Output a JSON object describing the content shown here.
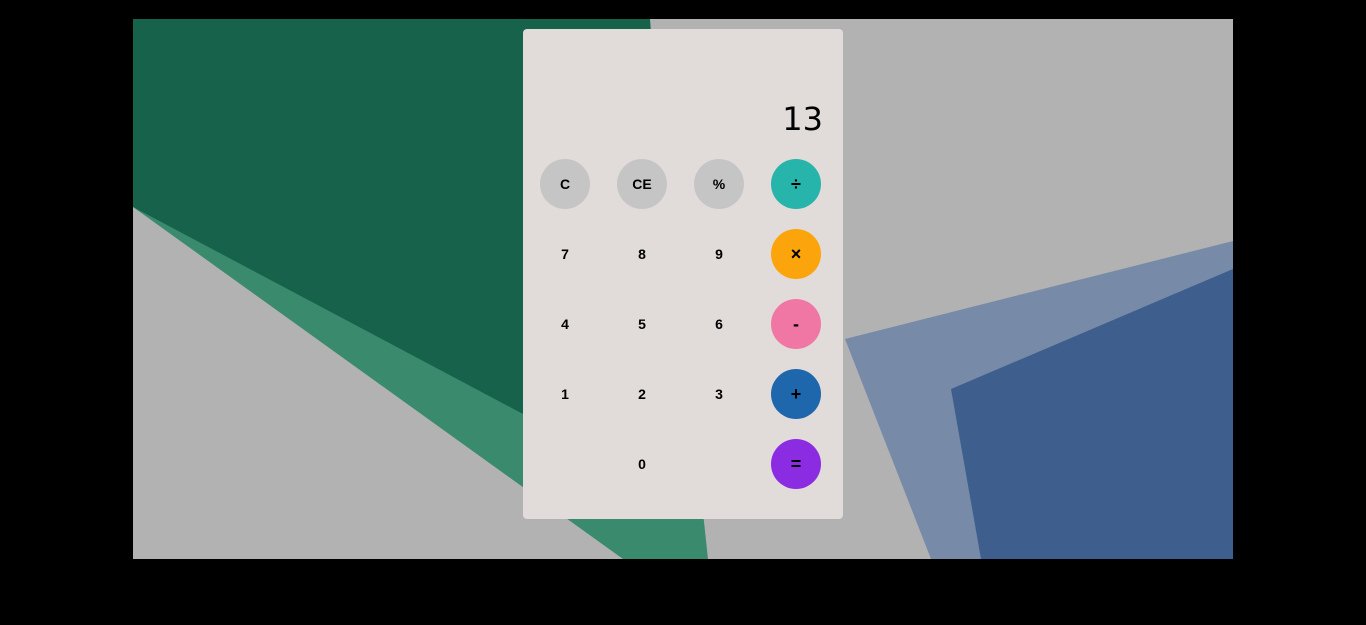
{
  "display": {
    "value": "13"
  },
  "keys": {
    "clear": "C",
    "clear_entry": "CE",
    "percent": "%",
    "divide": "÷",
    "seven": "7",
    "eight": "8",
    "nine": "9",
    "multiply": "×",
    "four": "4",
    "five": "5",
    "six": "6",
    "minus": "-",
    "one": "1",
    "two": "2",
    "three": "3",
    "plus": "+",
    "zero": "0",
    "equals": "="
  },
  "colors": {
    "divide": "#27b5ab",
    "multiply": "#fba40b",
    "minus": "#f076a4",
    "plus": "#1f67ad",
    "equals": "#8b2be2",
    "function_key": "#c6c5c5",
    "panel": "#e1dbda",
    "background": "#b2b2b2"
  }
}
